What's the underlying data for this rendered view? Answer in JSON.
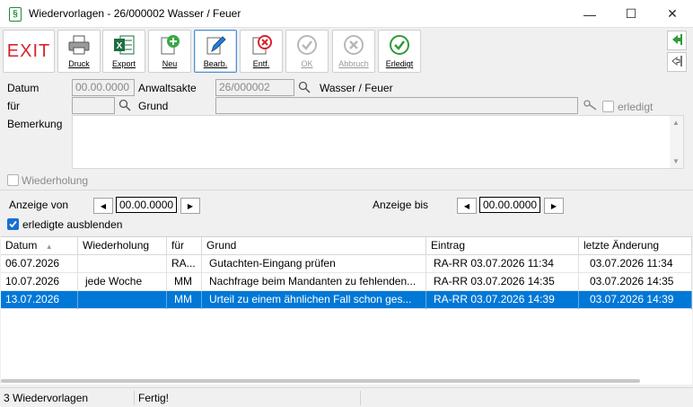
{
  "window": {
    "title": "Wiedervorlagen - 26/000002 Wasser / Feuer",
    "minimize": "—",
    "maximize": "☐",
    "close": "✕"
  },
  "toolbar": {
    "exit": "EXIT",
    "druck": "Druck",
    "export": "Export",
    "neu": "Neu",
    "bearb": "Bearb.",
    "entf": "Entf.",
    "ok": "OK",
    "abbruch": "Abbruch",
    "erledigt": "Erledigt"
  },
  "form": {
    "datum_label": "Datum",
    "datum_value": "00.00.0000",
    "anwaltsakte_label": "Anwaltsakte",
    "anwaltsakte_value": "26/000002",
    "akte_name": "Wasser / Feuer",
    "fuer_label": "für",
    "fuer_value": "",
    "grund_label": "Grund",
    "grund_value": "",
    "erledigt_label": "erledigt",
    "bemerkung_label": "Bemerkung",
    "bemerkung_value": "",
    "wiederholung_label": "Wiederholung"
  },
  "filter": {
    "von_label": "Anzeige von",
    "von_value": "00.00.0000",
    "bis_label": "Anzeige bis",
    "bis_value": "00.00.0000",
    "hide_done_label": "erledigte ausblenden"
  },
  "table": {
    "headers": [
      "Datum",
      "Wiederholung",
      "für",
      "Grund",
      "Eintrag",
      "letzte Änderung"
    ],
    "rows": [
      [
        "06.07.2026",
        "",
        "RA...",
        "Gutachten-Eingang prüfen",
        "RA-RR 03.07.2026  11:34",
        "03.07.2026  11:34"
      ],
      [
        "10.07.2026",
        "jede Woche",
        "MM",
        "Nachfrage beim Mandanten zu fehlenden...",
        "RA-RR 03.07.2026  14:35",
        "03.07.2026  14:35"
      ],
      [
        "13.07.2026",
        "",
        "MM",
        "Urteil zu einem ähnlichen Fall schon ges...",
        "RA-RR 03.07.2026  14:39",
        "03.07.2026  14:39"
      ]
    ]
  },
  "status": {
    "count": "3 Wiedervorlagen",
    "state": "Fertig!"
  }
}
